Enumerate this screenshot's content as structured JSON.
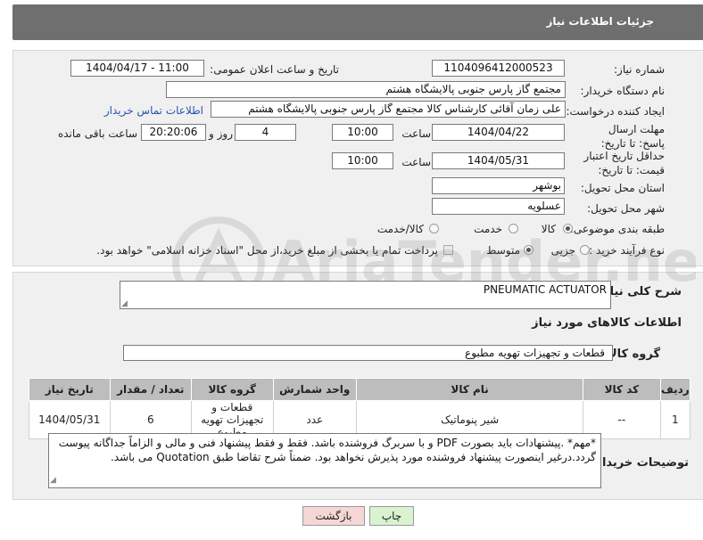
{
  "header": {
    "title": "جزئیات اطلاعات نیاز"
  },
  "fields": {
    "need_number_label": "شماره نیاز:",
    "need_number": "1104096412000523",
    "announce_label": "تاریخ و ساعت اعلان عمومی:",
    "announce_value": "1404/04/17 - 11:00",
    "buyer_org_label": "نام دستگاه خریدار:",
    "buyer_org": "مجتمع گاز پارس جنوبی  پالایشگاه هشتم",
    "creator_label": "ایجاد کننده درخواست:",
    "creator": "علی زمان آقائی کارشناس کالا مجتمع گاز پارس جنوبی  پالایشگاه هشتم",
    "contact_link": "اطلاعات تماس خریدار",
    "reply_deadline_label": "مهلت ارسال پاسخ: تا تاریخ:",
    "reply_date": "1404/04/22",
    "time_label": "ساعت",
    "reply_time": "10:00",
    "days": "4",
    "days_label": "روز و",
    "remaining": "20:20:06",
    "remaining_label": "ساعت باقی مانده",
    "price_validity_label": "حداقل تاریخ اعتبار قیمت: تا تاریخ:",
    "price_date": "1404/05/31",
    "price_time": "10:00",
    "province_label": "استان محل تحویل:",
    "province": "بوشهر",
    "city_label": "شهر محل تحویل:",
    "city": "عسلویه",
    "category_label": "طبقه بندی موضوعی:",
    "category_options": [
      "کالا",
      "خدمت",
      "کالا/خدمت"
    ],
    "process_label": "نوع فرآیند خرید :",
    "process_options": [
      "جزیی",
      "متوسط"
    ],
    "payment_note": "پرداخت تمام یا بخشی از مبلغ خرید،از محل \"اسناد خزانه اسلامی\" خواهد بود."
  },
  "description": {
    "label": "شرح کلی نیاز:",
    "value": "PNEUMATIC ACTUATOR",
    "items_title": "اطلاعات کالاهای مورد نیاز",
    "group_label": "گروه کالا:",
    "group_value": "قطعات و تجهیزات تهویه مطبوع"
  },
  "table": {
    "headers": [
      "ردیف",
      "کد کالا",
      "نام کالا",
      "واحد شمارش",
      "گروه کالا",
      "تعداد / مقدار",
      "تاریخ نیاز"
    ],
    "rows": [
      {
        "row": "1",
        "code": "--",
        "name": "شیر پنوماتیک",
        "unit": "عدد",
        "group": "قطعات و تجهیزات تهویه مطبوع",
        "qty": "6",
        "date": "1404/05/31"
      }
    ]
  },
  "buyer_notes": {
    "label": "توضیحات خریدار:",
    "text": "*مهم* .پیشنهادات باید بصورت PDF و با سربرگ فروشنده باشد. فقط و فقط پیشنهاد فنی و مالی و الزاماً جداگانه پیوست گردد.درغیر اینصورت پیشنهاد فروشنده مورد پذیرش نخواهد بود. ضمناً شرح تقاضا طبق Quotation می باشد."
  },
  "buttons": {
    "print": "چاپ",
    "back": "بازگشت"
  },
  "watermark": {
    "text": "AriaTender.neT"
  },
  "colors": {
    "header_bg": "#6f6f6f",
    "panel_bg": "#f0f0f0",
    "table_head": "#bdbdbd",
    "print_btn": "#d9f2d0",
    "back_btn": "#f7d6d6",
    "link": "#2a53b0"
  }
}
